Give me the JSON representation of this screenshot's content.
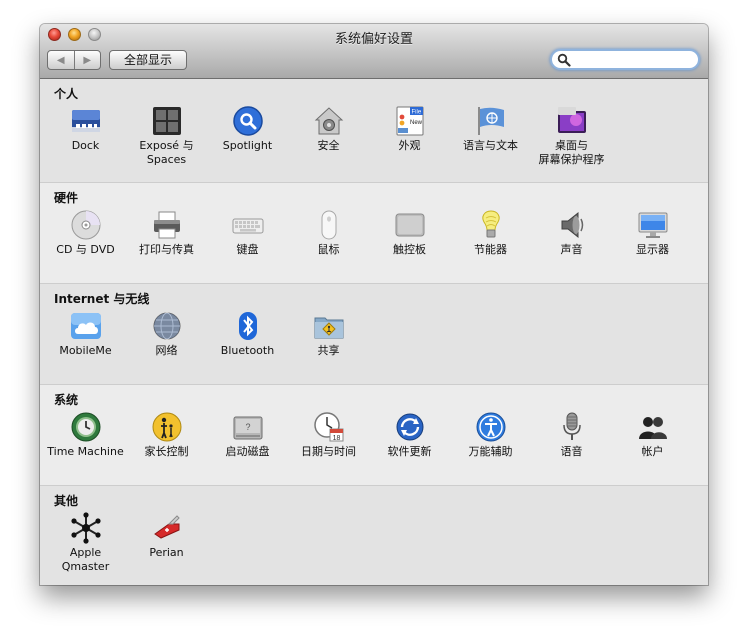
{
  "window": {
    "title": "系统偏好设置"
  },
  "toolbar": {
    "back_label": "◀",
    "forward_label": "▶",
    "show_all_label": "全部显示",
    "search_value": "",
    "search_icon": "magnifier-icon"
  },
  "sections": {
    "personal": {
      "title": "个人",
      "items": [
        {
          "label": "Dock",
          "icon": "dock-icon"
        },
        {
          "label": "Exposé 与\nSpaces",
          "icon": "expose-spaces-icon"
        },
        {
          "label": "Spotlight",
          "icon": "spotlight-icon"
        },
        {
          "label": "安全",
          "icon": "security-house-icon"
        },
        {
          "label": "外观",
          "icon": "appearance-icon"
        },
        {
          "label": "语言与文本",
          "icon": "un-flag-icon"
        },
        {
          "label": "桌面与\n屏幕保护程序",
          "icon": "desktop-screensaver-icon"
        }
      ]
    },
    "hardware": {
      "title": "硬件",
      "items": [
        {
          "label": "CD 与 DVD",
          "icon": "cd-dvd-icon"
        },
        {
          "label": "打印与传真",
          "icon": "printer-icon"
        },
        {
          "label": "键盘",
          "icon": "keyboard-icon"
        },
        {
          "label": "鼠标",
          "icon": "mouse-icon"
        },
        {
          "label": "触控板",
          "icon": "trackpad-icon"
        },
        {
          "label": "节能器",
          "icon": "energy-bulb-icon"
        },
        {
          "label": "声音",
          "icon": "speaker-icon"
        },
        {
          "label": "显示器",
          "icon": "display-icon"
        }
      ]
    },
    "internet": {
      "title": "Internet 与无线",
      "items": [
        {
          "label": "MobileMe",
          "icon": "cloud-icon"
        },
        {
          "label": "网络",
          "icon": "globe-icon"
        },
        {
          "label": "Bluetooth",
          "icon": "bluetooth-icon"
        },
        {
          "label": "共享",
          "icon": "sharing-folder-icon"
        }
      ]
    },
    "system": {
      "title": "系统",
      "items": [
        {
          "label": "Time Machine",
          "icon": "time-machine-icon"
        },
        {
          "label": "家长控制",
          "icon": "parental-controls-icon"
        },
        {
          "label": "启动磁盘",
          "icon": "hard-disk-icon"
        },
        {
          "label": "日期与时间",
          "icon": "clock-calendar-icon"
        },
        {
          "label": "软件更新",
          "icon": "software-update-icon"
        },
        {
          "label": "万能辅助",
          "icon": "accessibility-icon"
        },
        {
          "label": "语音",
          "icon": "microphone-icon"
        },
        {
          "label": "帐户",
          "icon": "accounts-icon"
        }
      ]
    },
    "other": {
      "title": "其他",
      "items": [
        {
          "label": "Apple\nQmaster",
          "icon": "qmaster-icon"
        },
        {
          "label": "Perian",
          "icon": "perian-knife-icon"
        }
      ]
    }
  }
}
